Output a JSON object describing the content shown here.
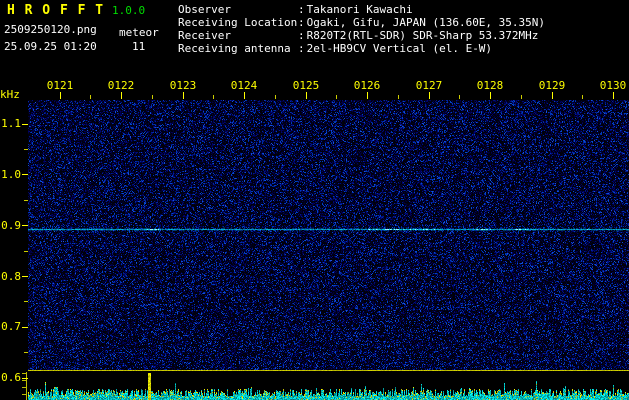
{
  "app": {
    "title": "H R O F F T",
    "version": "1.0.0"
  },
  "file": {
    "name": "2509250120.png",
    "mode": "meteor",
    "datetime": "25.09.25 01:20",
    "count": "11"
  },
  "info": {
    "separator": ":",
    "rows": [
      {
        "label": "Observer",
        "value": "Takanori Kawachi"
      },
      {
        "label": "Receiving Location",
        "value": "Ogaki, Gifu, JAPAN (136.60E, 35.35N)"
      },
      {
        "label": "Receiver",
        "value": "R820T2(RTL-SDR) SDR-Sharp 53.372MHz"
      },
      {
        "label": "Receiving antenna",
        "value": "2el-HB9CV Vertical (el. E-W)"
      }
    ]
  },
  "colors": {
    "background": "#000000",
    "title": "#ffff00",
    "version": "#00dd00",
    "header_text": "#ffffff",
    "axis_text": "#ffff00",
    "separator_yellow": "#d8d800",
    "noise_blue": "#0000c8",
    "carrier_cyan": "#00ccff",
    "strip_cyan": "#00e0e0",
    "strip_peak_yellow": "#ffff00"
  },
  "chart_data": {
    "type": "heatmap",
    "title": "HROFFT radio meteor echo spectrogram",
    "x_tick_labels": [
      "0121",
      "0122",
      "0123",
      "0124",
      "0125",
      "0126",
      "0127",
      "0128",
      "0129",
      "0130"
    ],
    "x_range_time": [
      "0120",
      "0130"
    ],
    "x_unit": "HHMM (1-minute divisions)",
    "y_axis_label": "kHz",
    "y_tick_labels": [
      "1.1",
      "1.0",
      "0.9",
      "0.8",
      "0.7",
      "0.6"
    ],
    "y_range_khz": [
      0.6,
      1.15
    ],
    "carrier_khz": 0.9,
    "echo_count": 11,
    "grid": false,
    "legend": false,
    "series_notes": "Dark-blue receiver noise background; continuous bright cyan carrier line at ~0.9 kHz with brighter bursts near 0122 and 0126-0127; yellow separator line above bottom strip; bottom strip is cyan signal-level trace vs time with yellow peaks and a tall spike near 0122."
  }
}
